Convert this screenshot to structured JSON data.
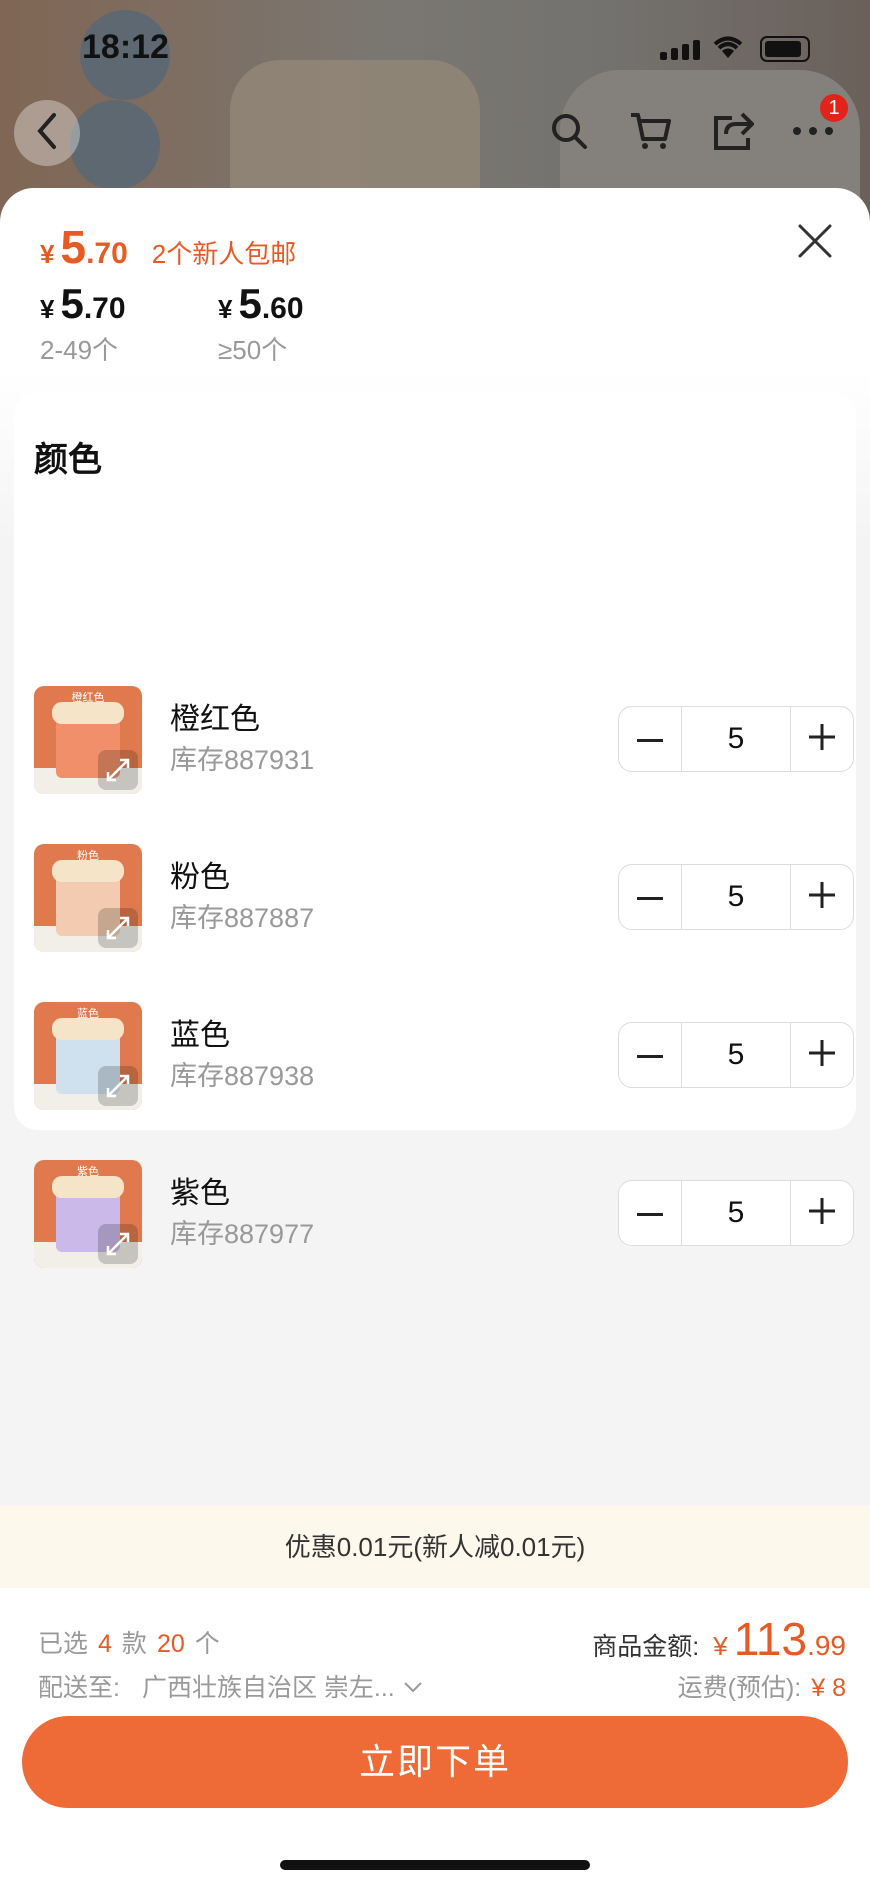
{
  "status": {
    "time": "18:12"
  },
  "nav": {
    "cart_badge": "1"
  },
  "price": {
    "currency": "¥",
    "main_int": "5",
    "main_dec": ".70",
    "promo": "2个新人包邮",
    "tiers": [
      {
        "int": "5",
        "dec": ".70",
        "qty": "2-49个"
      },
      {
        "int": "5",
        "dec": ".60",
        "qty": "≥50个"
      }
    ]
  },
  "panel": {
    "title": "颜色"
  },
  "variants": [
    {
      "name": "橙红色",
      "stock": "库存887931",
      "qty": "5",
      "thumb_label": "橙红色",
      "color": "#f08f6a"
    },
    {
      "name": "粉色",
      "stock": "库存887887",
      "qty": "5",
      "thumb_label": "粉色",
      "color": "#f3cbb0"
    },
    {
      "name": "蓝色",
      "stock": "库存887938",
      "qty": "5",
      "thumb_label": "蓝色",
      "color": "#cfe1ee"
    },
    {
      "name": "紫色",
      "stock": "库存887977",
      "qty": "5",
      "thumb_label": "紫色",
      "color": "#cbb9ea"
    }
  ],
  "discount": {
    "text": "优惠0.01元(新人减0.01元)"
  },
  "footer": {
    "selected_prefix": "已选",
    "styles_count": "4",
    "styles_unit": "款",
    "items_count": "20",
    "items_unit": "个",
    "amount_label": "商品金额:",
    "amount_currency": "¥",
    "amount_int": "113",
    "amount_dec": ".99",
    "ship_label": "配送至:",
    "ship_addr": "广西壮族自治区 崇左...",
    "freight_label": "运费(预估):",
    "freight_value": "¥ 8",
    "order_button": "立即下单"
  },
  "colors": {
    "accent": "#ee6b38",
    "price": "#e85a24"
  }
}
